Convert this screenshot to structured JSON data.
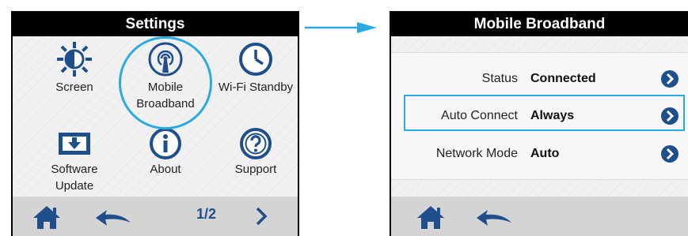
{
  "settings_screen": {
    "title": "Settings",
    "tiles": [
      {
        "icon": "brightness-icon",
        "label": "Screen"
      },
      {
        "icon": "mobile-broadband-icon",
        "label": "Mobile Broadband"
      },
      {
        "icon": "clock-icon",
        "label": "Wi-Fi Standby"
      },
      {
        "icon": "software-update-icon",
        "label": "Software Update"
      },
      {
        "icon": "info-icon",
        "label": "About"
      },
      {
        "icon": "question-icon",
        "label": "Support"
      }
    ],
    "footer": {
      "home_icon": "home-icon",
      "back_icon": "back-icon",
      "pager": "1/2",
      "next_icon": "chevron-right-icon"
    }
  },
  "broadband_screen": {
    "title": "Mobile Broadband",
    "rows": [
      {
        "label": "Status",
        "value": "Connected"
      },
      {
        "label": "Auto Connect",
        "value": "Always"
      },
      {
        "label": "Network Mode",
        "value": "Auto"
      }
    ],
    "footer": {
      "home_icon": "home-icon",
      "back_icon": "back-icon"
    }
  },
  "colors": {
    "highlight": "#29abe2",
    "icon_blue": "#1f4e8c",
    "title_bar": "#000000",
    "footer": "#d4d4d4"
  }
}
